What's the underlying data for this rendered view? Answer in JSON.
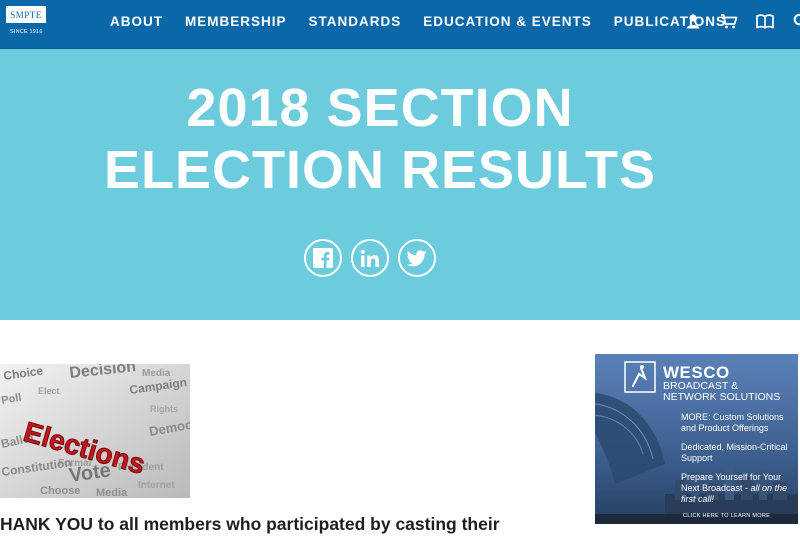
{
  "header": {
    "logo": {
      "text": "SMPTE",
      "since": "SINCE 1916"
    },
    "nav": [
      "ABOUT",
      "MEMBERSHIP",
      "STANDARDS",
      "EDUCATION & EVENTS",
      "PUBLICATIONS"
    ],
    "icons": [
      "user-icon",
      "cart-icon",
      "book-icon",
      "search-icon"
    ]
  },
  "hero": {
    "title_line1": "2018 SECTION",
    "title_line2": "ELECTION RESULTS",
    "social": [
      "facebook-icon",
      "linkedin-icon",
      "twitter-icon"
    ]
  },
  "content": {
    "image_word": "Elections",
    "headline": "HANK YOU to all members who participated by casting their"
  },
  "ad": {
    "brand": "WESCO",
    "subtitle": "BROADCAST & NETWORK SOLUTIONS",
    "text1": "MORE: Custom Solutions and Product Offerings",
    "text2": "Dedicated, Mission-Critical Support",
    "text3": "Prepare Yourself for Your Next Broadcast -",
    "text3_italic": "all on the first call!",
    "cta": "CLICK HERE TO LEARN MORE"
  },
  "colors": {
    "nav_bg": "#0a67a8",
    "hero_bg": "#6ccbdc",
    "text_dark": "#1f1f1f"
  }
}
